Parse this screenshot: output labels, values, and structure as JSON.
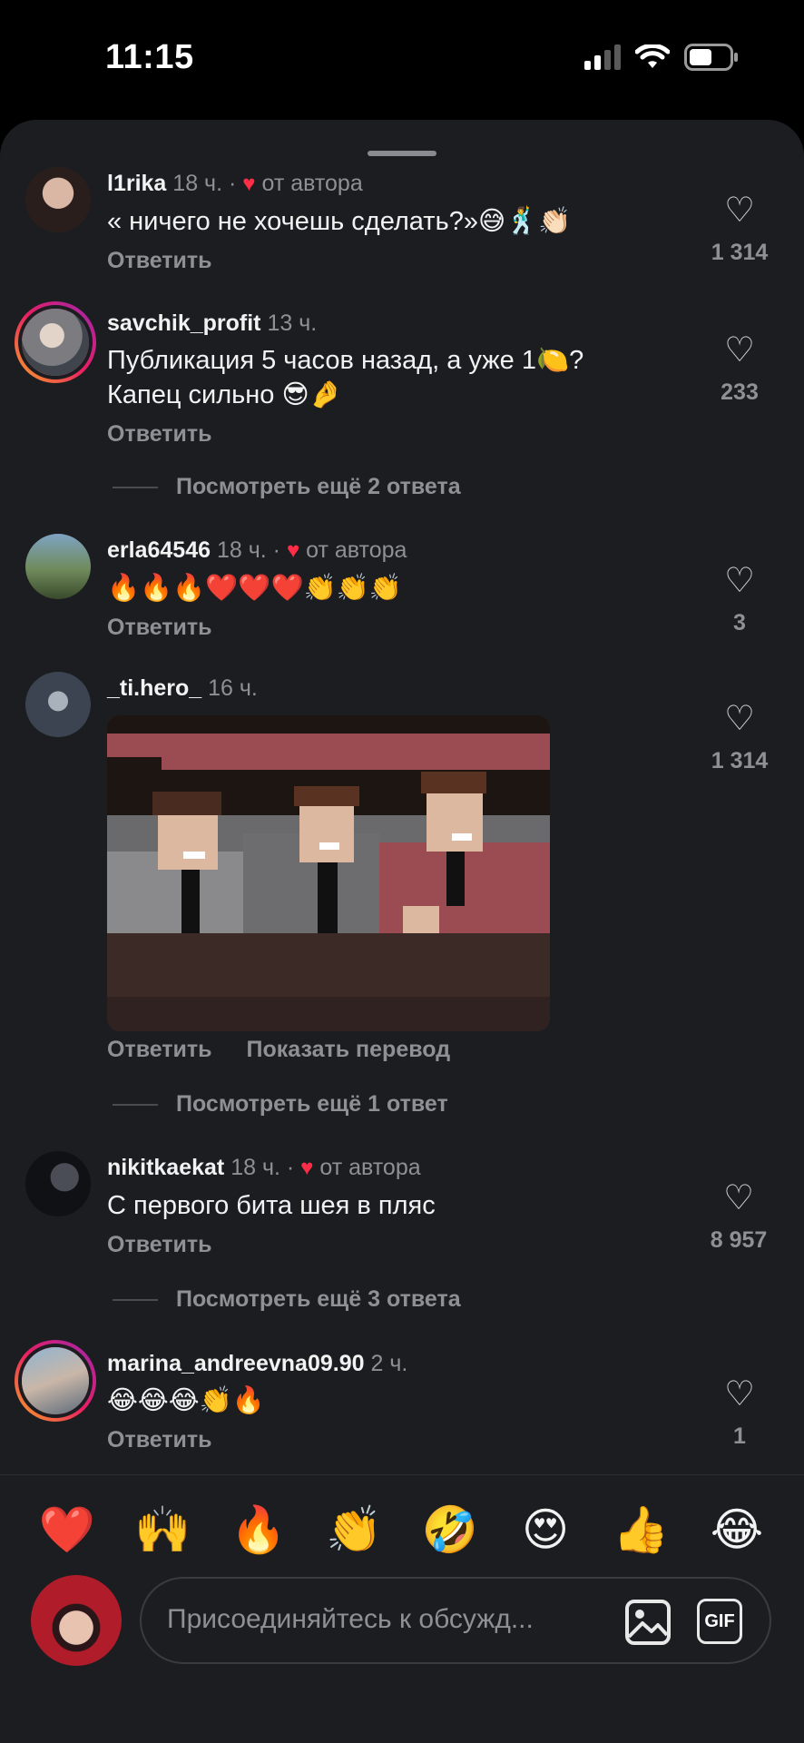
{
  "status": {
    "time": "11:15"
  },
  "comments": [
    {
      "user": "l1rika",
      "time": "18 ч.",
      "author_like": "от автора",
      "text": "« ничего не хочешь сделать?»😅🕺👏🏻",
      "reply": "Ответить",
      "likes": "1 314"
    },
    {
      "user": "savchik_profit",
      "time": "13 ч.",
      "text_line1": "Публикация 5 часов назад, а уже 1🍋?",
      "text_line2": "Капец сильно 😎🤌",
      "reply": "Ответить",
      "likes": "233",
      "more": "Посмотреть ещё 2 ответа"
    },
    {
      "user": "erla64546",
      "time": "18 ч.",
      "author_like": "от автора",
      "text": "🔥🔥🔥❤️❤️❤️👏👏👏",
      "reply": "Ответить",
      "likes": "3"
    },
    {
      "user": "_ti.hero_",
      "time": "16 ч.",
      "reply": "Ответить",
      "translate": "Показать перевод",
      "likes": "1 314",
      "more": "Посмотреть ещё 1 ответ"
    },
    {
      "user": "nikitkaekat",
      "time": "18 ч.",
      "author_like": "от автора",
      "text": "С первого бита шея в пляс",
      "reply": "Ответить",
      "likes": "8 957",
      "more": "Посмотреть ещё 3 ответа"
    },
    {
      "user": "marina_andreevna09.90",
      "time": "2 ч.",
      "text": "😂😂😂👏🔥",
      "reply": "Ответить",
      "likes": "1"
    }
  ],
  "reactions": [
    "❤️",
    "🙌",
    "🔥",
    "👏",
    "🤣",
    "😍",
    "👍",
    "😂"
  ],
  "composer": {
    "placeholder": "Присоединяйтесь к обсужд...",
    "gif_label": "GIF"
  },
  "colors": {
    "background": "#1c1d21",
    "muted": "#8f9096",
    "author_heart": "#ff2d46"
  }
}
